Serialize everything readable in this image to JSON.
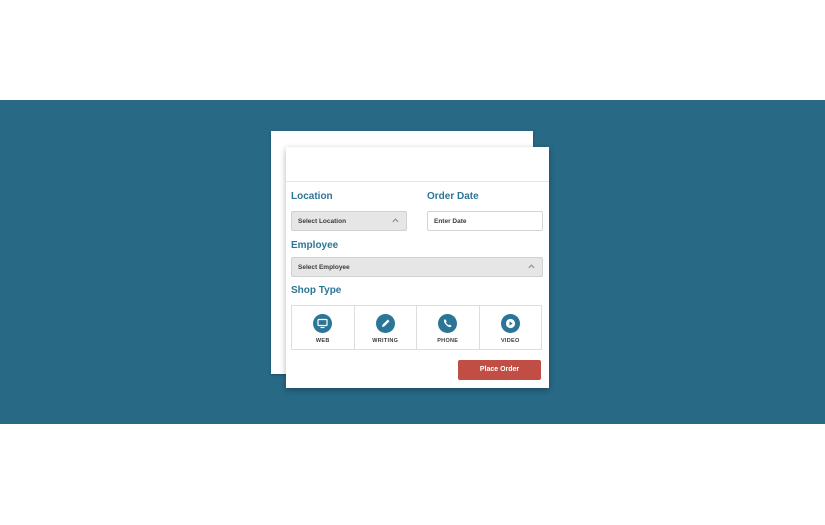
{
  "theme": {
    "band_color": "#286986",
    "label_color": "#2b7596",
    "button_color": "#c14e44"
  },
  "form": {
    "location_label": "Location",
    "location_placeholder": "Select Location",
    "order_date_label": "Order Date",
    "order_date_placeholder": "Enter Date",
    "employee_label": "Employee",
    "employee_placeholder": "Select Employee",
    "shop_type_label": "Shop Type",
    "shop_types": [
      {
        "label": "WEB",
        "icon": "monitor-icon"
      },
      {
        "label": "WRITING",
        "icon": "pencil-icon"
      },
      {
        "label": "PHONE",
        "icon": "phone-icon"
      },
      {
        "label": "VIDEO",
        "icon": "play-icon"
      }
    ],
    "submit_label": "Place Order"
  }
}
